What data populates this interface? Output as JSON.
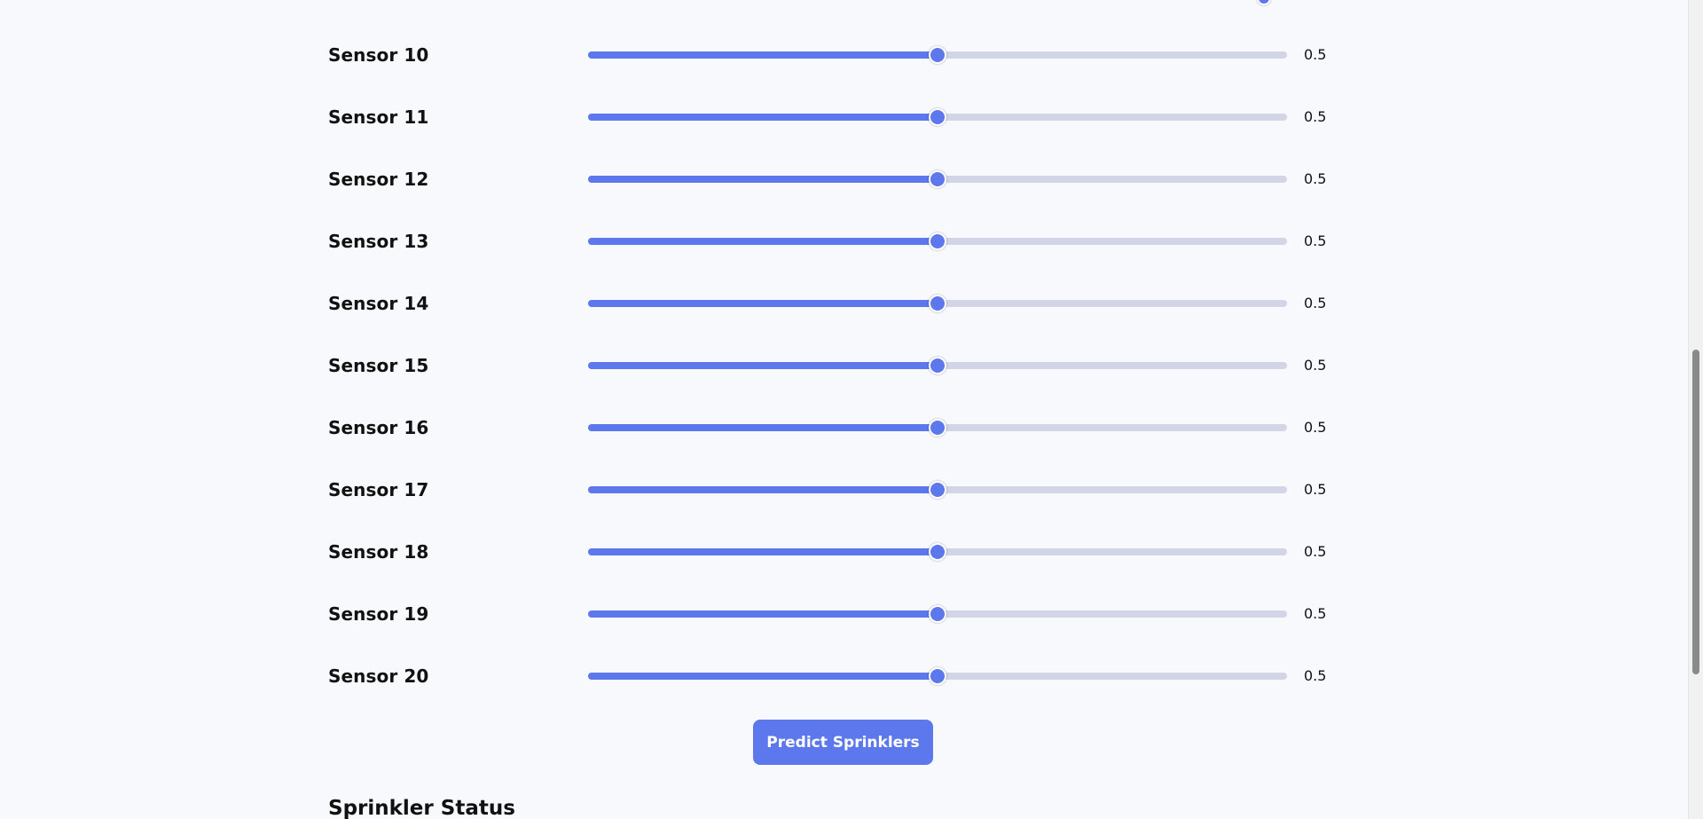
{
  "accent_color": "#5c78ec",
  "track_color": "#d1d5e6",
  "sensors": [
    {
      "label": "Sensor 10",
      "value": 0.5,
      "value_text": "0.5"
    },
    {
      "label": "Sensor 11",
      "value": 0.5,
      "value_text": "0.5"
    },
    {
      "label": "Sensor 12",
      "value": 0.5,
      "value_text": "0.5"
    },
    {
      "label": "Sensor 13",
      "value": 0.5,
      "value_text": "0.5"
    },
    {
      "label": "Sensor 14",
      "value": 0.5,
      "value_text": "0.5"
    },
    {
      "label": "Sensor 15",
      "value": 0.5,
      "value_text": "0.5"
    },
    {
      "label": "Sensor 16",
      "value": 0.5,
      "value_text": "0.5"
    },
    {
      "label": "Sensor 17",
      "value": 0.5,
      "value_text": "0.5"
    },
    {
      "label": "Sensor 18",
      "value": 0.5,
      "value_text": "0.5"
    },
    {
      "label": "Sensor 19",
      "value": 0.5,
      "value_text": "0.5"
    },
    {
      "label": "Sensor 20",
      "value": 0.5,
      "value_text": "0.5"
    }
  ],
  "predict_button_label": "Predict Sprinklers",
  "section_heading": "Sprinkler Status"
}
